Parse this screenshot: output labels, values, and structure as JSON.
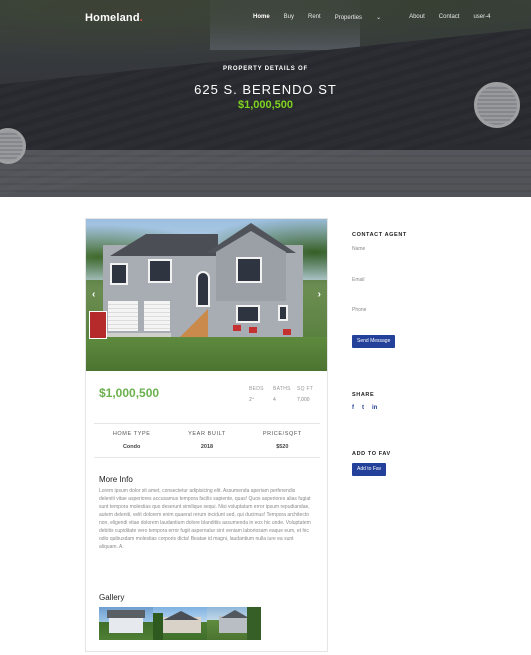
{
  "nav": {
    "logo": "Homeland",
    "logo_dot": ".",
    "items": [
      "Home",
      "Buy",
      "Rent",
      "Properties",
      "About",
      "Contact",
      "user-4"
    ],
    "properties_chevron": "⌄"
  },
  "hero": {
    "subtitle": "PROPERTY DETAILS OF",
    "title": "625 S. BERENDO ST",
    "price": "$1,000,500"
  },
  "listing": {
    "price": "$1,000,500",
    "stats": [
      {
        "label": "BEDS",
        "value": "2⁺"
      },
      {
        "label": "BATHS",
        "value": "4"
      },
      {
        "label": "SQ FT",
        "value": "7,000"
      }
    ],
    "facts": [
      {
        "label": "HOME TYPE",
        "value": "Condo"
      },
      {
        "label": "YEAR BUILT",
        "value": "2018"
      },
      {
        "label": "PRICE/SQFT",
        "value": "$520"
      }
    ],
    "more_info_title": "More Info",
    "more_info_text": "Lorem ipsum dolor sit amet, consectetur adipisicing elit. Assumenda aperiam perferendis deleniti vitae asperiores accusamus tempora facilis sapiente, quas! Quos asperiores alias fugiat sunt tempora molestias quo deserunt similique sequi. Nisi voluptatum error ipsum repudiandae, autem deleniti, velit dolorem enim quaerat rerum incidunt sed, qui ducimus! Tempora architecto non, eligendi vitae dolorem laudantium dolore blanditiis assumenda in eos hic unde. Voluptatem debitis cupiditate vero tempora error fugit aspernatur sint veniam laboriosam eaque eum, et hic odio quibusdam molestias corporis dicta! Beatae id magni, laudantium nulla iure ea sunt aliquam. A.",
    "gallery_title": "Gallery",
    "prev_arrow": "‹",
    "next_arrow": "›"
  },
  "sidebar": {
    "contact_title": "CONTACT AGENT",
    "name_label": "Name",
    "email_label": "Email",
    "phone_label": "Phone",
    "send_label": "Send Message",
    "share_title": "SHARE",
    "share_icons": [
      "f",
      "t",
      "in"
    ],
    "fav_title": "ADD TO FAV",
    "fav_label": "Add to Fav"
  },
  "colors": {
    "accent_green": "#6ab04c",
    "button_blue": "#23409a",
    "logo_dot": "#e64c3c"
  },
  "icons": {
    "facebook": "facebook-icon",
    "twitter": "twitter-icon",
    "linkedin": "linkedin-icon"
  }
}
